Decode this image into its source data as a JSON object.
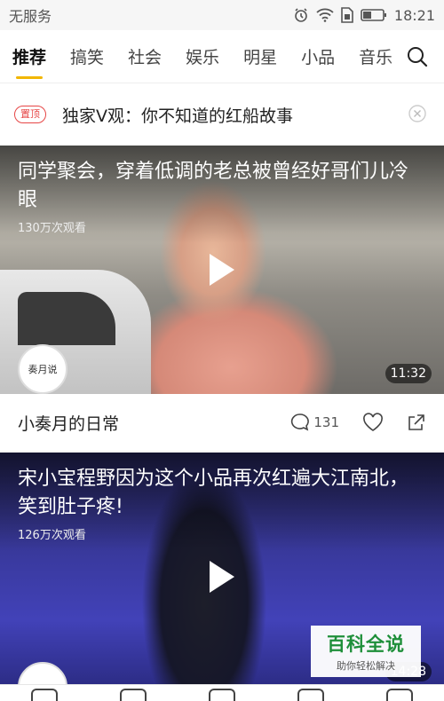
{
  "status": {
    "carrier": "无服务",
    "time": "18:21"
  },
  "tabs": [
    "推荐",
    "搞笑",
    "社会",
    "娱乐",
    "明星",
    "小品",
    "音乐"
  ],
  "pinned": {
    "badge": "置顶",
    "title": "独家V观：你不知道的红船故事"
  },
  "videos": [
    {
      "title": "同学聚会，穿着低调的老总被曾经好哥们儿冷眼",
      "views": "130万次观看",
      "duration": "11:32",
      "author": "小奏月的日常",
      "avatar_text": "奏月说",
      "comments": "131"
    },
    {
      "title": "宋小宝程野因为这个小品再次红遍大江南北，笑到肚子疼!",
      "views": "126万次观看",
      "duration": "14:28"
    }
  ],
  "watermark": {
    "main": "百科全说",
    "sub": "助你轻松解决"
  },
  "colors": {
    "accent": "#f2b600",
    "pin_red": "#e64646",
    "watermark_green": "#1e8f3a"
  }
}
